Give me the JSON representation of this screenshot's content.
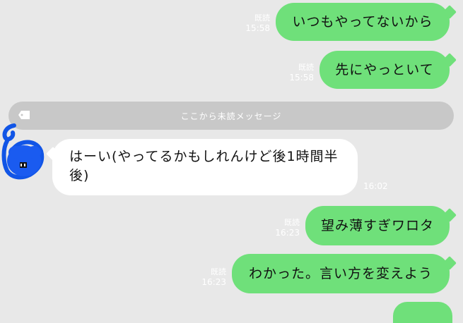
{
  "outgoing": [
    {
      "text": "いつもやってないから",
      "read": "既読",
      "time": "15:58"
    },
    {
      "text": "先にやっといて",
      "read": "既読",
      "time": "15:58"
    },
    {
      "text": "望み薄すぎワロタ",
      "read": "既読",
      "time": "16:23"
    },
    {
      "text": "わかった。言い方を変えよう",
      "read": "既読",
      "time": "16:23"
    }
  ],
  "divider": {
    "label": "ここから未読メッセージ"
  },
  "incoming": [
    {
      "text": "はーい(やってるかもしれんけど後1時間半後)",
      "time": "16:02"
    }
  ],
  "colors": {
    "outgoing_bubble": "#6fe07a",
    "incoming_bubble": "#ffffff",
    "background": "#e8e8e8"
  },
  "icons": {
    "divider": "tag-icon",
    "avatar": "blue-scribble-avatar"
  }
}
